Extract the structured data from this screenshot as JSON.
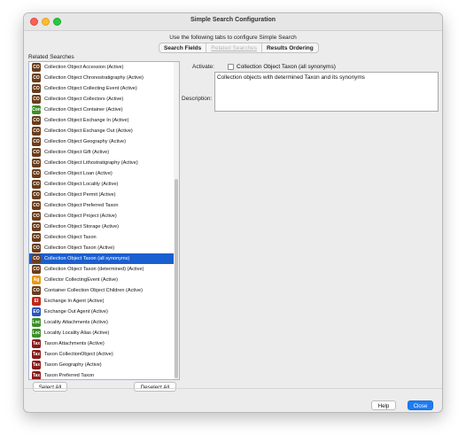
{
  "window": {
    "title": "Simple Search Configuration"
  },
  "header": {
    "subtitle": "Use the following tabs to configure Simple Search"
  },
  "tabs": [
    {
      "label": "Search Fields",
      "state": "active"
    },
    {
      "label": "Related Searches",
      "state": "disabled"
    },
    {
      "label": "Results Ordering",
      "state": "active"
    }
  ],
  "related_searches": {
    "label": "Related Searches",
    "items": [
      {
        "icon": "CO",
        "color": "#6b3d1c",
        "label": "Collection Object Accession (Active)"
      },
      {
        "icon": "CO",
        "color": "#6b3d1c",
        "label": "Collection Object Chronostratigraphy (Active)"
      },
      {
        "icon": "CO",
        "color": "#6b3d1c",
        "label": "Collection Object Collecting Event (Active)"
      },
      {
        "icon": "CO",
        "color": "#6b3d1c",
        "label": "Collection Object Collectors (Active)"
      },
      {
        "icon": "Con",
        "color": "#3f8f2a",
        "label": "Collection Object Container (Active)"
      },
      {
        "icon": "CO",
        "color": "#6b3d1c",
        "label": "Collection Object Exchange In (Active)"
      },
      {
        "icon": "CO",
        "color": "#6b3d1c",
        "label": "Collection Object Exchange Out (Active)"
      },
      {
        "icon": "CO",
        "color": "#6b3d1c",
        "label": "Collection Object Geography (Active)"
      },
      {
        "icon": "CO",
        "color": "#6b3d1c",
        "label": "Collection Object Gift (Active)"
      },
      {
        "icon": "CO",
        "color": "#6b3d1c",
        "label": "Collection Object Lithostratigraphy (Active)"
      },
      {
        "icon": "CO",
        "color": "#6b3d1c",
        "label": "Collection Object Loan (Active)"
      },
      {
        "icon": "CO",
        "color": "#6b3d1c",
        "label": "Collection Object Locality (Active)"
      },
      {
        "icon": "CO",
        "color": "#6b3d1c",
        "label": "Collection Object Permit (Active)"
      },
      {
        "icon": "CO",
        "color": "#6b3d1c",
        "label": "Collection Object Preferred Taxon"
      },
      {
        "icon": "CO",
        "color": "#6b3d1c",
        "label": "Collection Object Project (Active)"
      },
      {
        "icon": "CO",
        "color": "#6b3d1c",
        "label": "Collection Object Storage (Active)"
      },
      {
        "icon": "CO",
        "color": "#6b3d1c",
        "label": "Collection Object Taxon"
      },
      {
        "icon": "CO",
        "color": "#6b3d1c",
        "label": "Collection Object Taxon (Active)"
      },
      {
        "icon": "CO",
        "color": "#6b3d1c",
        "label": "Collection Object Taxon (all synonyms)",
        "selected": true
      },
      {
        "icon": "CO",
        "color": "#6b3d1c",
        "label": "Collection Object Taxon (determined) (Active)"
      },
      {
        "icon": "Ag",
        "color": "#e69a1a",
        "label": "Collector CollectingEvent (Active)"
      },
      {
        "icon": "CO",
        "color": "#6b3d1c",
        "label": "Container Collection Object Children (Active)"
      },
      {
        "icon": "EI",
        "color": "#c0281c",
        "label": "Exchange In Agent (Active)"
      },
      {
        "icon": "EO",
        "color": "#2b55b8",
        "label": "Exchange Out Agent (Active)"
      },
      {
        "icon": "Loc",
        "color": "#3f8f2a",
        "label": "Locality Attachments (Active)"
      },
      {
        "icon": "Loc",
        "color": "#3f8f2a",
        "label": "Locality Locality Alias (Active)"
      },
      {
        "icon": "Tax",
        "color": "#8a1b1b",
        "label": "Taxon Attachments (Active)"
      },
      {
        "icon": "Tax",
        "color": "#8a1b1b",
        "label": "Taxon CollectionObject (Active)"
      },
      {
        "icon": "Tax",
        "color": "#8a1b1b",
        "label": "Taxon Geography (Active)"
      },
      {
        "icon": "Tax",
        "color": "#8a1b1b",
        "label": "Taxon Preferred Taxon"
      }
    ],
    "select_all": "Select All",
    "deselect_all": "Deselect All"
  },
  "detail": {
    "activate_label": "Activate:",
    "activate_checked": false,
    "activate_text": "Collection Object Taxon (all synonyms)",
    "description_label": "Description:",
    "description_text": "Collection objects with determined Taxon and its synonyms"
  },
  "footer": {
    "help": "Help",
    "close": "Close"
  }
}
